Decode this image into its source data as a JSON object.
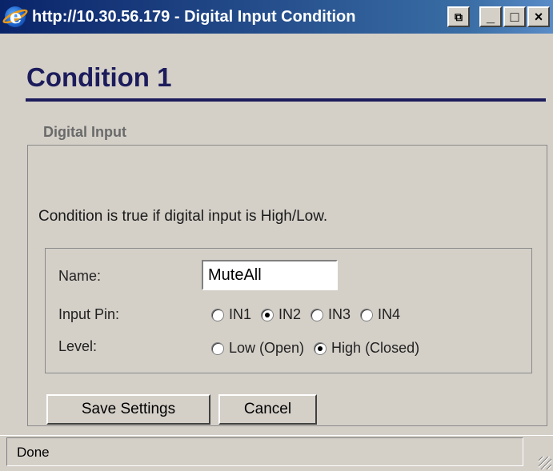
{
  "window": {
    "title": "http://10.30.56.179 - Digital Input Condition",
    "buttons": {
      "popout": "⧉",
      "minimize": "_",
      "maximize": "□",
      "close": "×"
    }
  },
  "page": {
    "title": "Condition 1",
    "section_legend": "Digital Input",
    "description": "Condition is true if digital input is High/Low."
  },
  "form": {
    "name_label": "Name:",
    "name_value": "MuteAll",
    "input_pin_label": "Input Pin:",
    "input_pin_options": [
      "IN1",
      "IN2",
      "IN3",
      "IN4"
    ],
    "input_pin_selected": "IN2",
    "level_label": "Level:",
    "level_options": [
      "Low (Open)",
      "High (Closed)"
    ],
    "level_selected": "High (Closed)"
  },
  "actions": {
    "save_label": "Save Settings",
    "cancel_label": "Cancel"
  },
  "status": {
    "text": "Done"
  },
  "icons": [
    "ie-icon",
    "popout-icon",
    "minimize-icon",
    "maximize-icon",
    "close-icon",
    "resize-grip-icon"
  ]
}
